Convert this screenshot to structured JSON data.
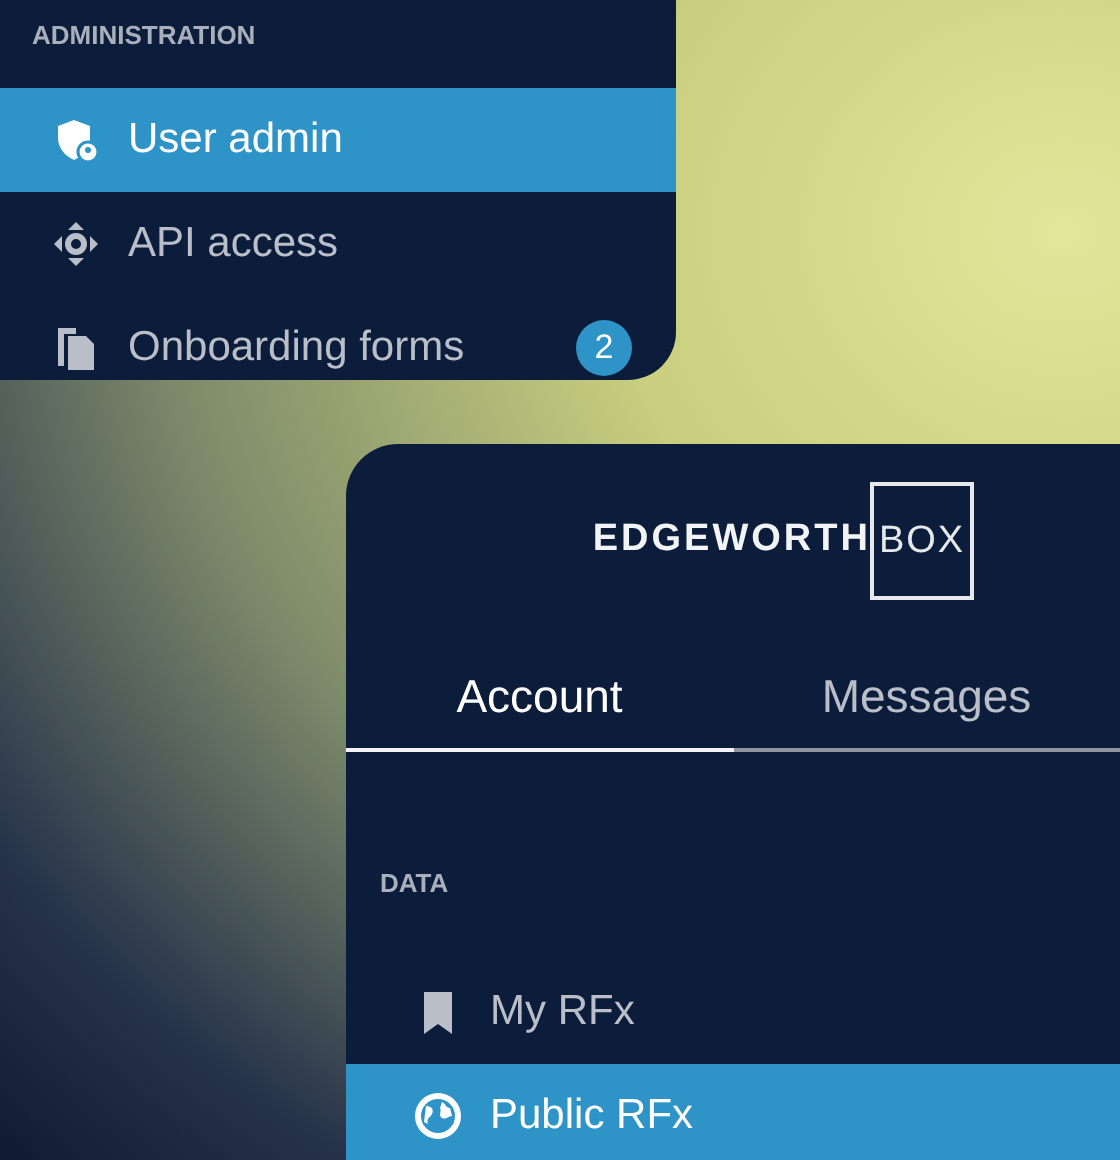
{
  "administration_panel": {
    "heading": "ADMINISTRATION",
    "items": [
      {
        "label": "User admin",
        "selected": true
      },
      {
        "label": "API access",
        "selected": false
      },
      {
        "label": "Onboarding forms",
        "selected": false,
        "badge": "2"
      }
    ]
  },
  "account_panel": {
    "logo": {
      "text": "EDGEWORTH",
      "boxed_text": "BOX"
    },
    "tabs": [
      {
        "label": "Account",
        "selected": true
      },
      {
        "label": "Messages",
        "selected": false
      }
    ],
    "section": "DATA",
    "items": [
      {
        "label": "My RFx",
        "selected": false
      },
      {
        "label": "Public RFx",
        "selected": true
      }
    ]
  }
}
